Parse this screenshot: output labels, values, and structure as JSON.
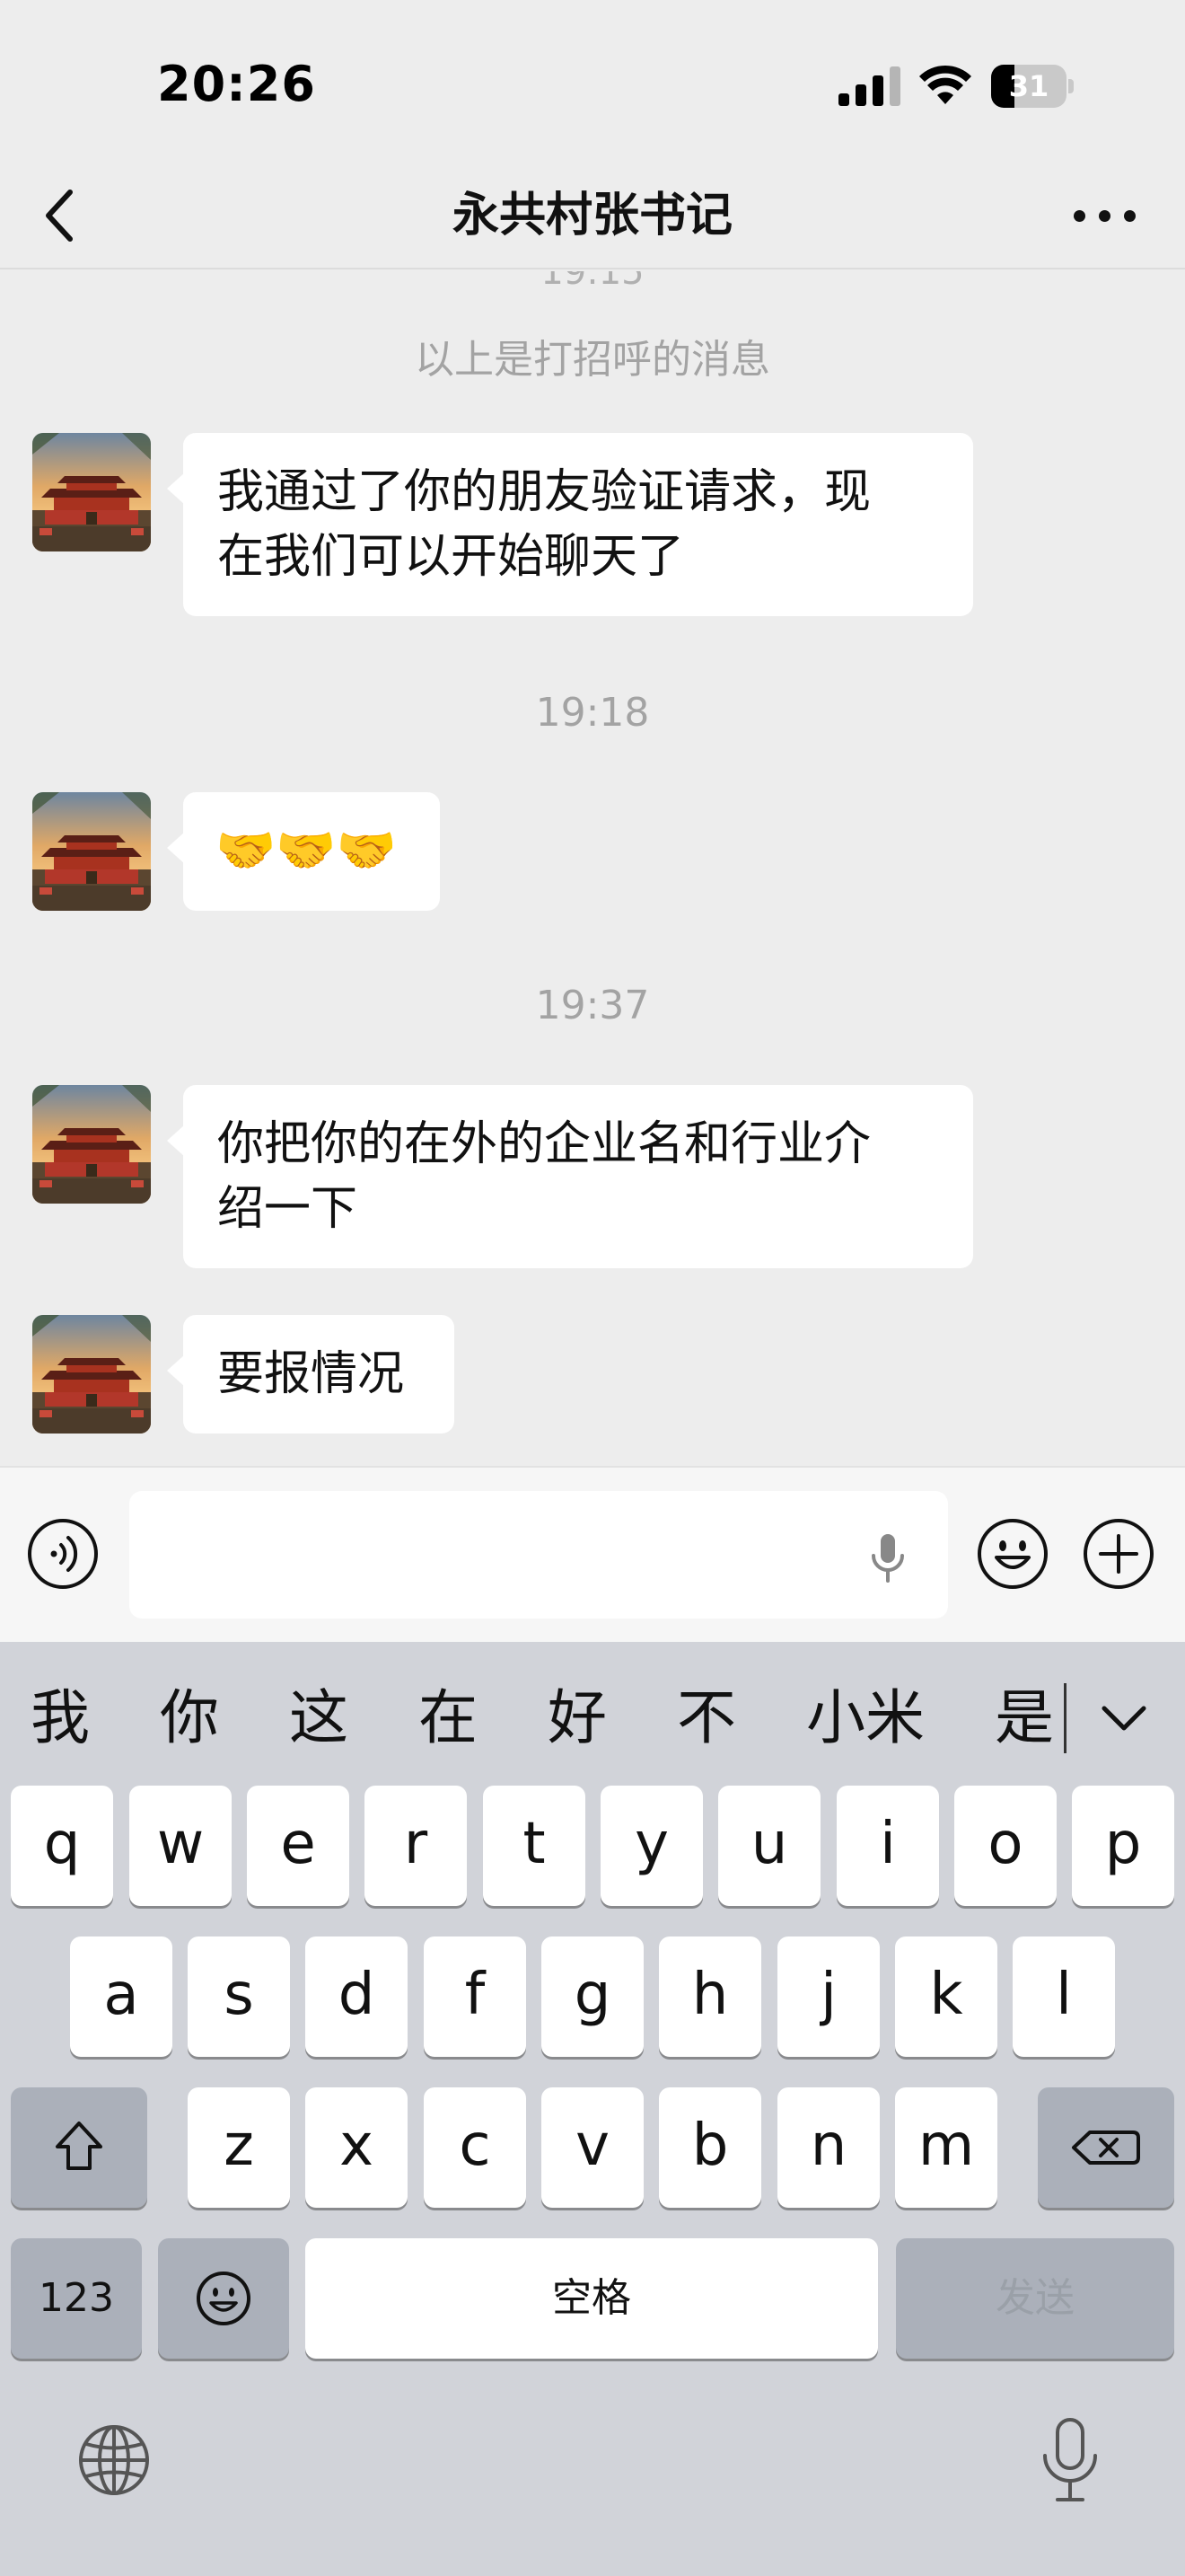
{
  "status_bar": {
    "time": "20:26",
    "battery": "31",
    "battery_level_percent": 31,
    "signal_bars": 3,
    "signal_bars_total": 4
  },
  "nav": {
    "title": "永共村张书记"
  },
  "chat": {
    "partial_timestamp": "19:15",
    "system_message": "以上是打招呼的消息",
    "messages": [
      {
        "text_line1": "我通过了你的朋友验证请求，现",
        "text_line2": "在我们可以开始聊天了"
      },
      {
        "timestamp": "19:18",
        "text": "🤝🤝🤝"
      },
      {
        "timestamp": "19:37",
        "text_line1": "你把你的在外的企业名和行业介",
        "text_line2": "绍一下"
      },
      {
        "text": "要报情况"
      }
    ]
  },
  "input_bar": {
    "value": "",
    "placeholder": ""
  },
  "keyboard": {
    "candidates": [
      "我",
      "你",
      "这",
      "在",
      "好",
      "不",
      "小米",
      "是"
    ],
    "row1": [
      "q",
      "w",
      "e",
      "r",
      "t",
      "y",
      "u",
      "i",
      "o",
      "p"
    ],
    "row2": [
      "a",
      "s",
      "d",
      "f",
      "g",
      "h",
      "j",
      "k",
      "l"
    ],
    "row3": [
      "z",
      "x",
      "c",
      "v",
      "b",
      "n",
      "m"
    ],
    "numbers_label": "123",
    "space_label": "空格",
    "send_label": "发送"
  },
  "colors": {
    "background": "#ededed",
    "bubble": "#ffffff",
    "keyboard": "#d1d3d9",
    "send_disabled_text": "#9aa0a8"
  }
}
